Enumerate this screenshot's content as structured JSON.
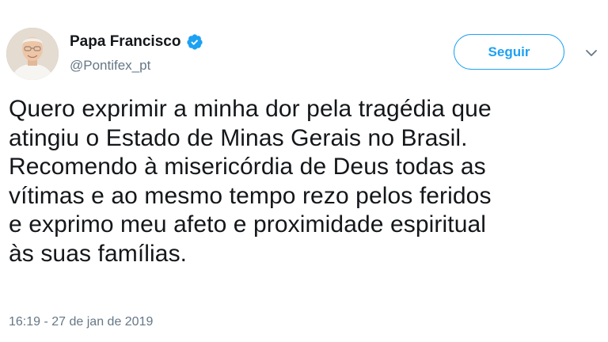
{
  "author": {
    "display_name": "Papa Francisco",
    "handle": "@Pontifex_pt",
    "verified_icon": "verified-badge-icon",
    "avatar_icon": "avatar-photo"
  },
  "actions": {
    "follow_label": "Seguir",
    "menu_icon": "chevron-down-icon"
  },
  "tweet": {
    "lines": [
      "Quero exprimir a minha dor pela tragédia que",
      "atingiu o Estado de Minas Gerais no Brasil.",
      "Recomendo à misericórdia de Deus todas as",
      "vítimas e ao mesmo tempo rezo pelos feridos",
      "e exprimo meu afeto e proximidade espiritual",
      "às suas famílias."
    ],
    "timestamp": "16:19 - 27 de jan de 2019"
  },
  "colors": {
    "accent": "#1da1f2",
    "text": "#14171a",
    "muted": "#657786"
  }
}
